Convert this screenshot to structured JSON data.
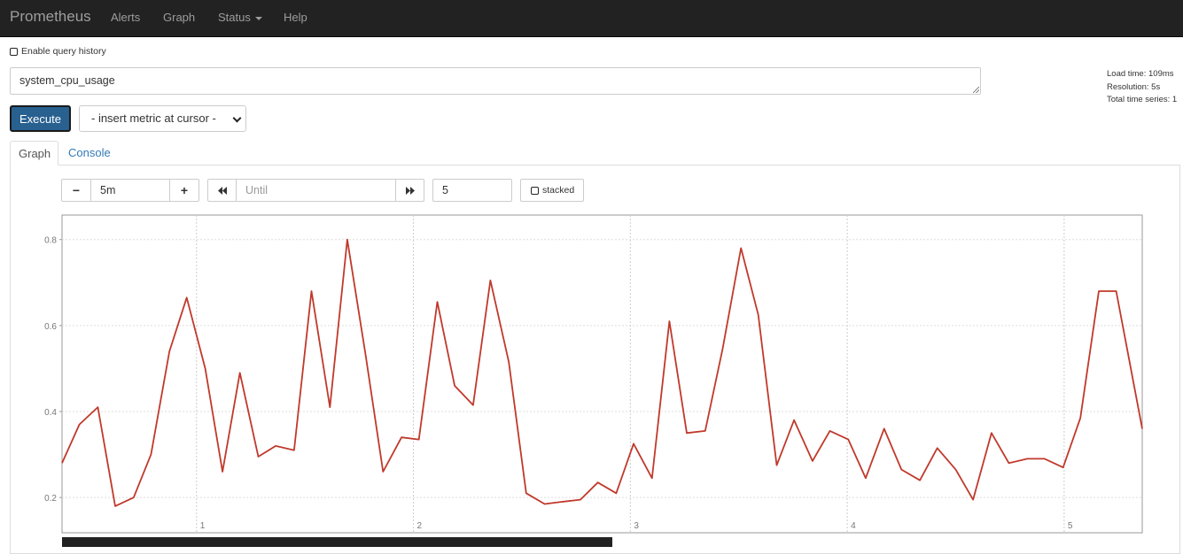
{
  "nav": {
    "brand": "Prometheus",
    "alerts": "Alerts",
    "graph": "Graph",
    "status": "Status",
    "help": "Help"
  },
  "query_history": {
    "label": "Enable query history",
    "checked": false
  },
  "expression": {
    "value": "system_cpu_usage"
  },
  "stats": {
    "load_time": "Load time: 109ms",
    "resolution": "Resolution: 5s",
    "total_series": "Total time series: 1"
  },
  "execute": {
    "label": "Execute"
  },
  "metric_select": {
    "selected": "- insert metric at cursor -"
  },
  "tabs": {
    "graph": "Graph",
    "console": "Console",
    "active": "Graph"
  },
  "controls": {
    "minus": "−",
    "plus": "+",
    "range": "5m",
    "until_placeholder": "Until",
    "resolution": "5",
    "stacked_label": "stacked"
  },
  "colors": {
    "navbar": "#222222",
    "execute": "#286090",
    "series": "#c0392b",
    "link": "#337ab7"
  },
  "chart_data": {
    "type": "line",
    "xlim": [
      0.38,
      5.36
    ],
    "ylim": [
      0.118,
      0.857
    ],
    "x_ticks": [
      "1",
      "2",
      "3",
      "4",
      "5"
    ],
    "y_ticks": [
      "0.2",
      "0.4",
      "0.6",
      "0.8"
    ],
    "grid": true,
    "series": [
      {
        "color": "#c0392b",
        "points": [
          [
            0.38,
            0.28
          ],
          [
            0.46,
            0.37
          ],
          [
            0.545,
            0.41
          ],
          [
            0.625,
            0.18
          ],
          [
            0.71,
            0.2
          ],
          [
            0.79,
            0.3
          ],
          [
            0.875,
            0.54
          ],
          [
            0.955,
            0.665
          ],
          [
            1.04,
            0.5
          ],
          [
            1.12,
            0.26
          ],
          [
            1.2,
            0.49
          ],
          [
            1.285,
            0.295
          ],
          [
            1.365,
            0.32
          ],
          [
            1.45,
            0.31
          ],
          [
            1.53,
            0.68
          ],
          [
            1.615,
            0.41
          ],
          [
            1.695,
            0.8
          ],
          [
            1.78,
            0.53
          ],
          [
            1.86,
            0.26
          ],
          [
            1.945,
            0.34
          ],
          [
            2.025,
            0.335
          ],
          [
            2.11,
            0.655
          ],
          [
            2.19,
            0.46
          ],
          [
            2.275,
            0.415
          ],
          [
            2.355,
            0.705
          ],
          [
            2.44,
            0.515
          ],
          [
            2.52,
            0.21
          ],
          [
            2.605,
            0.185
          ],
          [
            2.685,
            0.19
          ],
          [
            2.77,
            0.195
          ],
          [
            2.85,
            0.235
          ],
          [
            2.935,
            0.21
          ],
          [
            3.015,
            0.325
          ],
          [
            3.1,
            0.245
          ],
          [
            3.18,
            0.61
          ],
          [
            3.26,
            0.35
          ],
          [
            3.345,
            0.355
          ],
          [
            3.425,
            0.545
          ],
          [
            3.51,
            0.78
          ],
          [
            3.59,
            0.625
          ],
          [
            3.675,
            0.275
          ],
          [
            3.755,
            0.38
          ],
          [
            3.84,
            0.285
          ],
          [
            3.92,
            0.355
          ],
          [
            4.005,
            0.335
          ],
          [
            4.085,
            0.245
          ],
          [
            4.17,
            0.36
          ],
          [
            4.25,
            0.265
          ],
          [
            4.335,
            0.24
          ],
          [
            4.415,
            0.315
          ],
          [
            4.5,
            0.265
          ],
          [
            4.58,
            0.195
          ],
          [
            4.665,
            0.35
          ],
          [
            4.745,
            0.28
          ],
          [
            4.83,
            0.29
          ],
          [
            4.91,
            0.29
          ],
          [
            4.995,
            0.27
          ],
          [
            5.075,
            0.385
          ],
          [
            5.16,
            0.68
          ],
          [
            5.24,
            0.68
          ],
          [
            5.36,
            0.36
          ]
        ]
      }
    ]
  }
}
